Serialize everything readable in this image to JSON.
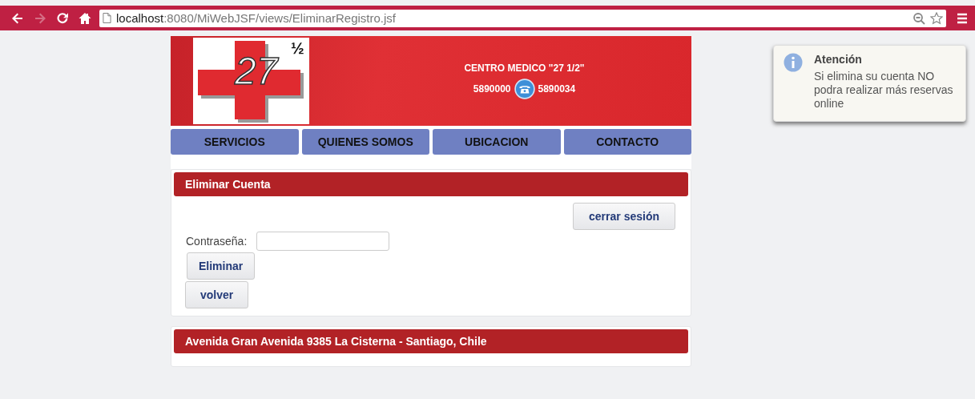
{
  "browser": {
    "url_host": "localhost",
    "url_path": ":8080/MiWebJSF/views/EliminarRegistro.jsf",
    "forward_disabled": true
  },
  "header": {
    "logo_number": "27",
    "logo_fraction": "½",
    "title": "CENTRO MEDICO \"27 1/2\"",
    "phone_1": "5890000",
    "phone_2": "5890034"
  },
  "nav": [
    "SERVICIOS",
    "QUIENES SOMOS",
    "UBICACION",
    "CONTACTO"
  ],
  "panel": {
    "title": "Eliminar Cuenta",
    "logout_button": "cerrar sesión",
    "password_label": "Contraseña:",
    "delete_button": "Eliminar",
    "back_button": "volver"
  },
  "footer": {
    "address": "Avenida Gran Avenida 9385 La Cisterna - Santiago, Chile"
  },
  "notification": {
    "title": "Atención",
    "message": "Si elimina su cuenta NO podra realizar más reservas online"
  }
}
